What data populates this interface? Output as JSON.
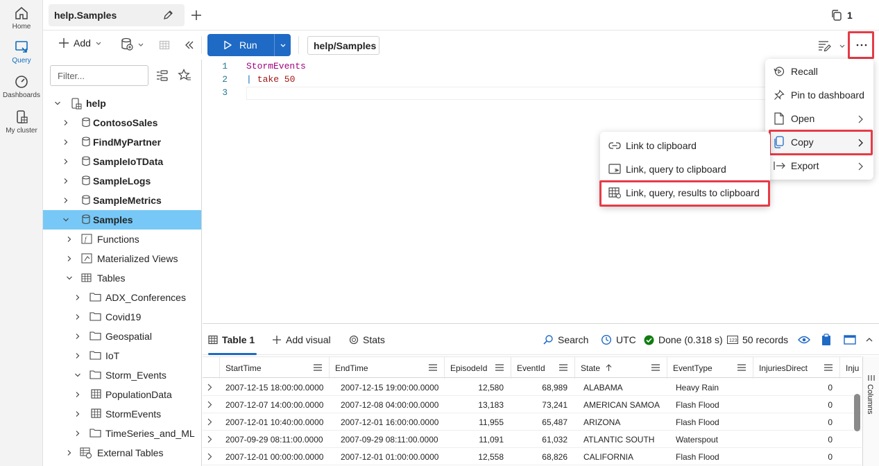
{
  "rail": {
    "items": [
      {
        "label": "Home",
        "icon": "home-icon"
      },
      {
        "label": "Query",
        "icon": "query-icon"
      },
      {
        "label": "Dashboards",
        "icon": "dashboards-icon"
      },
      {
        "label": "My cluster",
        "icon": "my-cluster-icon"
      }
    ]
  },
  "tabs": {
    "active_label": "help.Samples",
    "count": "1"
  },
  "toolbar": {
    "add_label": "Add",
    "run_label": "Run",
    "scope_label": "help/Samples"
  },
  "tree": {
    "filter_placeholder": "Filter...",
    "rows": [
      {
        "label": "help"
      },
      {
        "label": "ContosoSales"
      },
      {
        "label": "FindMyPartner"
      },
      {
        "label": "SampleIoTData"
      },
      {
        "label": "SampleLogs"
      },
      {
        "label": "SampleMetrics"
      },
      {
        "label": "Samples"
      },
      {
        "label": "Functions"
      },
      {
        "label": "Materialized Views"
      },
      {
        "label": "Tables"
      },
      {
        "label": "ADX_Conferences"
      },
      {
        "label": "Covid19"
      },
      {
        "label": "Geospatial"
      },
      {
        "label": "IoT"
      },
      {
        "label": "Storm_Events"
      },
      {
        "label": "PopulationData"
      },
      {
        "label": "StormEvents"
      },
      {
        "label": "TimeSeries_and_ML"
      },
      {
        "label": "External Tables"
      }
    ]
  },
  "editor": {
    "lines": [
      {
        "num": "1",
        "text": "StormEvents"
      },
      {
        "num": "2",
        "pipe": "|",
        "text": " take 50"
      },
      {
        "num": "3",
        "text": ""
      }
    ]
  },
  "results": {
    "tab_label": "Table 1",
    "add_visual": "Add visual",
    "stats": "Stats",
    "search": "Search",
    "timezone": "UTC",
    "status": "Done (0.318 s)",
    "records": "50 records",
    "columns_label": "Columns",
    "columns": [
      "StartTime",
      "EndTime",
      "EpisodeId",
      "EventId",
      "State",
      "EventType",
      "InjuriesDirect",
      "Inju"
    ],
    "rows": [
      [
        "2007-12-15 18:00:00.0000",
        "2007-12-15 19:00:00.0000",
        "12,580",
        "68,989",
        "ALABAMA",
        "Heavy Rain",
        "0"
      ],
      [
        "2007-12-07 14:00:00.0000",
        "2007-12-08 04:00:00.0000",
        "13,183",
        "73,241",
        "AMERICAN SAMOA",
        "Flash Flood",
        "0"
      ],
      [
        "2007-12-01 10:40:00.0000",
        "2007-12-01 16:00:00.0000",
        "11,955",
        "65,487",
        "ARIZONA",
        "Flash Flood",
        "0"
      ],
      [
        "2007-09-29 08:11:00.0000",
        "2007-09-29 08:11:00.0000",
        "11,091",
        "61,032",
        "ATLANTIC SOUTH",
        "Waterspout",
        "0"
      ],
      [
        "2007-12-01 00:00:00.0000",
        "2007-12-01 01:00:00.0000",
        "12,558",
        "68,826",
        "CALIFORNIA",
        "Flash Flood",
        "0"
      ]
    ]
  },
  "more_menu": {
    "items": [
      {
        "label": "Recall"
      },
      {
        "label": "Pin to dashboard"
      },
      {
        "label": "Open"
      },
      {
        "label": "Copy"
      },
      {
        "label": "Export"
      }
    ]
  },
  "copy_menu": {
    "items": [
      {
        "label": "Link to clipboard"
      },
      {
        "label": "Link, query to clipboard"
      },
      {
        "label": "Link, query, results to clipboard"
      }
    ]
  },
  "colors": {
    "accent": "#1f6ac5",
    "selected_row": "#77c8f6",
    "highlight": "#e63b46",
    "keyword": "#a31515",
    "table_name": "#a1007f"
  }
}
